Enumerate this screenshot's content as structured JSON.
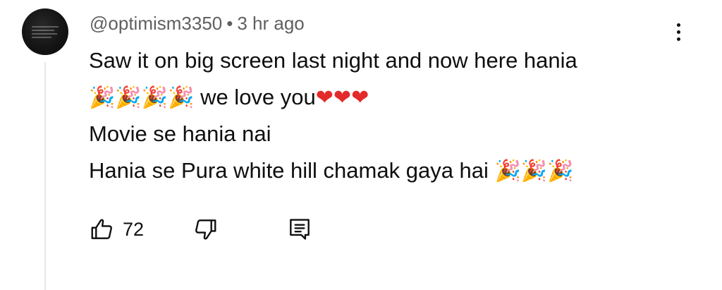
{
  "comment": {
    "author": "@optimism3350",
    "separator": "•",
    "timestamp": "3 hr ago",
    "lines": [
      "Saw it on big screen last night and now here hania",
      "we love you",
      "Movie se hania nai",
      "Hania se Pura white hill chamak gaya hai"
    ],
    "emojis": {
      "party": "🎉",
      "heart": "❤"
    },
    "likes": "72"
  },
  "icons": {
    "avatar": "avatar-icon",
    "more": "more-vert-icon",
    "like": "thumb-up-icon",
    "dislike": "thumb-down-icon",
    "reply": "comment-reply-icon"
  },
  "colors": {
    "meta_text": "#606060",
    "body_text": "#0f0f0f",
    "heart": "#e32a2a",
    "thread_line": "#e8e8e8"
  }
}
